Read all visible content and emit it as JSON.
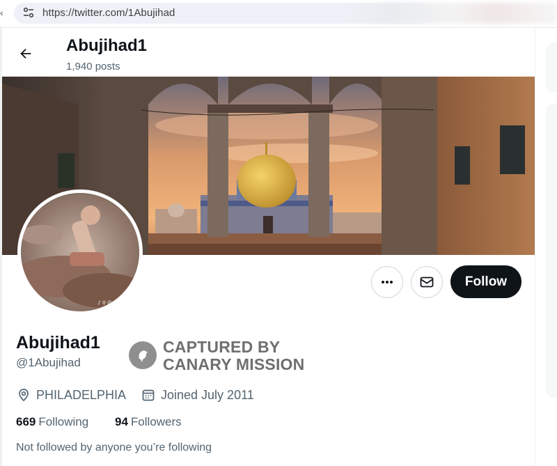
{
  "browser": {
    "url": "https://twitter.com/1Abujihad",
    "site_info_icon": "tune-icon"
  },
  "header": {
    "back_icon": "arrow-left-icon",
    "title": "Abujihad1",
    "post_count": "1,940 posts"
  },
  "banner": {
    "description_icon": "banner-image"
  },
  "actions": {
    "more_icon": "more-horizontal-icon",
    "message_icon": "mail-icon",
    "follow_label": "Follow",
    "follow_bg": "#0f1419"
  },
  "profile": {
    "display_name": "Abujihad1",
    "handle": "@1Abujihad",
    "location": "PHILADELPHIA",
    "location_icon": "location-pin-icon",
    "joined": "Joined July 2011",
    "joined_icon": "calendar-icon",
    "following_count": "669",
    "following_label": "Following",
    "followers_count": "94",
    "followers_label": "Followers",
    "followed_note": "Not followed by anyone you’re following"
  },
  "watermark": {
    "line1": "CAPTURED BY",
    "line2": "CANARY MISSION",
    "logo_icon": "canary-bird-logo"
  },
  "colors": {
    "primary_text": "#0f1419",
    "secondary_text": "#536471",
    "border": "#cfd9de"
  }
}
